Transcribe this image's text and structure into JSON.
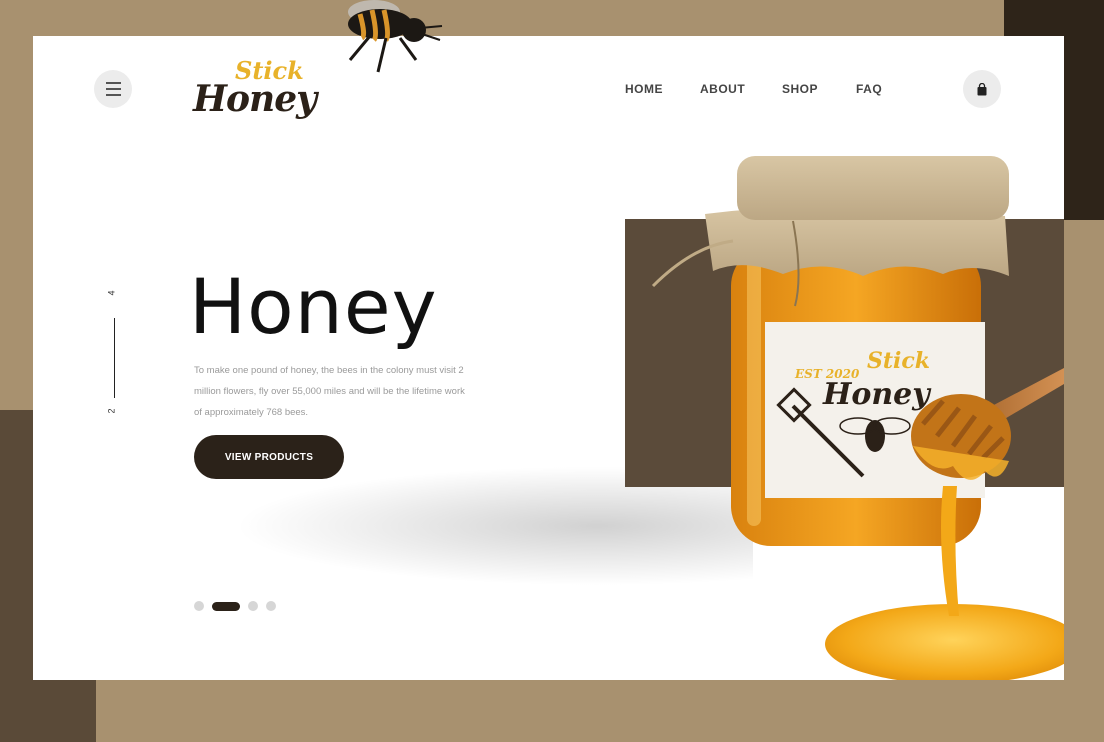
{
  "brand": {
    "logo_top": "Stick",
    "logo_main": "Honey"
  },
  "nav": {
    "items": [
      "HOME",
      "ABOUT",
      "SHOP",
      "FAQ"
    ]
  },
  "pager": {
    "current": "2",
    "total": "4"
  },
  "hero": {
    "title": "Honey",
    "description": "To make one pound of honey, the bees in the colony must visit 2 million flowers, fly over 55,000 miles and will be the lifetime work of approximately 768 bees.",
    "cta_label": "VIEW PRODUCTS"
  },
  "jar_label": {
    "est": "EST 2020",
    "top": "Stick",
    "main": "Honey"
  },
  "slider": {
    "count": 4,
    "active_index": 1
  },
  "colors": {
    "accent_gold": "#e8b22a",
    "dark_brown": "#2b2219",
    "tan": "#a8916f",
    "block_brown": "#5b4b3a"
  },
  "icons": {
    "menu": "hamburger-icon",
    "cart": "shopping-bag-icon"
  }
}
